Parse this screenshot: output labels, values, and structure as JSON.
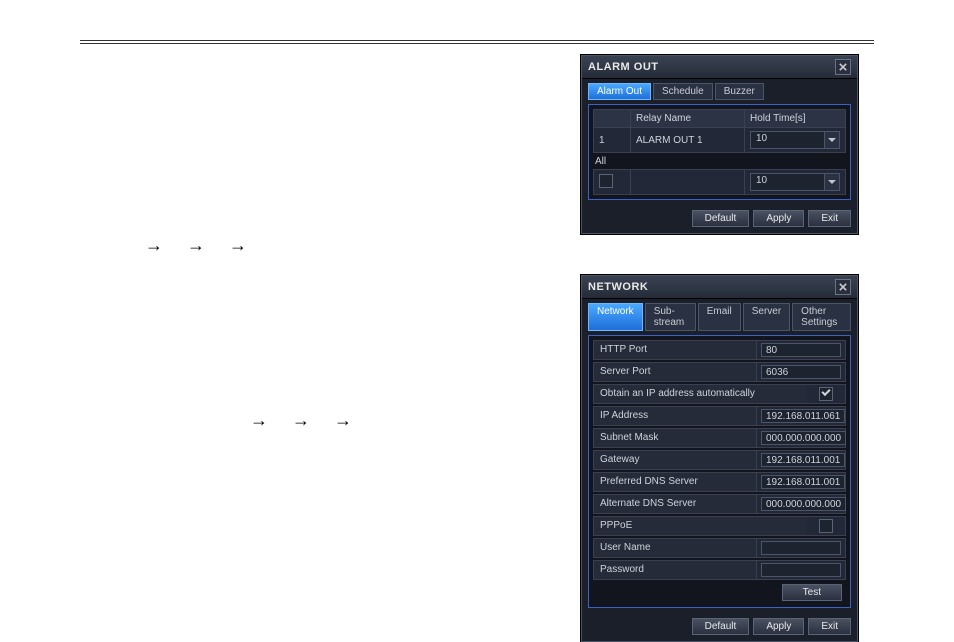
{
  "arrows": "→→→",
  "alarm": {
    "title": "ALARM OUT",
    "tabs": [
      "Alarm Out",
      "Schedule",
      "Buzzer"
    ],
    "active_tab": 0,
    "headers": {
      "blank": "",
      "relay": "Relay Name",
      "hold": "Hold Time[s]"
    },
    "rows": [
      {
        "idx": "1",
        "name": "ALARM OUT 1",
        "hold": "10"
      }
    ],
    "all_label": "All",
    "all_hold": "10",
    "buttons": {
      "default": "Default",
      "apply": "Apply",
      "exit": "Exit"
    }
  },
  "network": {
    "title": "NETWORK",
    "tabs": [
      "Network",
      "Sub-stream",
      "Email",
      "Server",
      "Other Settings"
    ],
    "active_tab": 0,
    "fields": {
      "http_port": {
        "label": "HTTP Port",
        "value": "80"
      },
      "server_port": {
        "label": "Server Port",
        "value": "6036"
      },
      "obtain_ip": {
        "label": "Obtain an IP address automatically",
        "checked": true
      },
      "ip_address": {
        "label": "IP Address",
        "value": "192.168.011.061"
      },
      "subnet_mask": {
        "label": "Subnet Mask",
        "value": "000.000.000.000"
      },
      "gateway": {
        "label": "Gateway",
        "value": "192.168.011.001"
      },
      "pref_dns": {
        "label": "Preferred DNS Server",
        "value": "192.168.011.001"
      },
      "alt_dns": {
        "label": "Alternate DNS Server",
        "value": "000.000.000.000"
      },
      "pppoe": {
        "label": "PPPoE",
        "checked": false
      },
      "user_name": {
        "label": "User Name",
        "value": ""
      },
      "password": {
        "label": "Password",
        "value": ""
      }
    },
    "test_button": "Test",
    "buttons": {
      "default": "Default",
      "apply": "Apply",
      "exit": "Exit"
    }
  }
}
